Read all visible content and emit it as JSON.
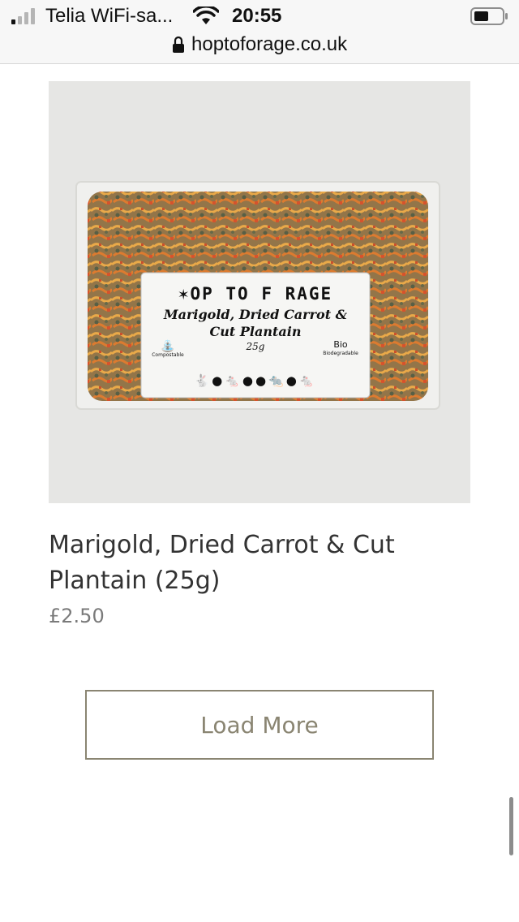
{
  "status_bar": {
    "carrier": "Telia WiFi-sa...",
    "time": "20:55",
    "icons": [
      "signal-icon",
      "wifi-icon",
      "battery-icon"
    ]
  },
  "browser": {
    "url": "hoptoforage.co.uk",
    "icons": [
      "lock-icon"
    ]
  },
  "product": {
    "package_label": {
      "brand": "OP TO F RAGE",
      "name_line1": "Marigold, Dried Carrot &",
      "name_line2": "Cut Plantain",
      "weight": "25g",
      "badge_left": "Compostable",
      "badge_right_bio": "Bio",
      "badge_right": "Biodegradable"
    },
    "title": "Marigold, Dried Carrot & Cut Plantain (25g)",
    "price": "£2.50"
  },
  "actions": {
    "load_more": "Load More"
  },
  "colors": {
    "accent": "#8a8572",
    "price_text": "#7a7a7a",
    "image_bg": "#e6e6e4"
  }
}
